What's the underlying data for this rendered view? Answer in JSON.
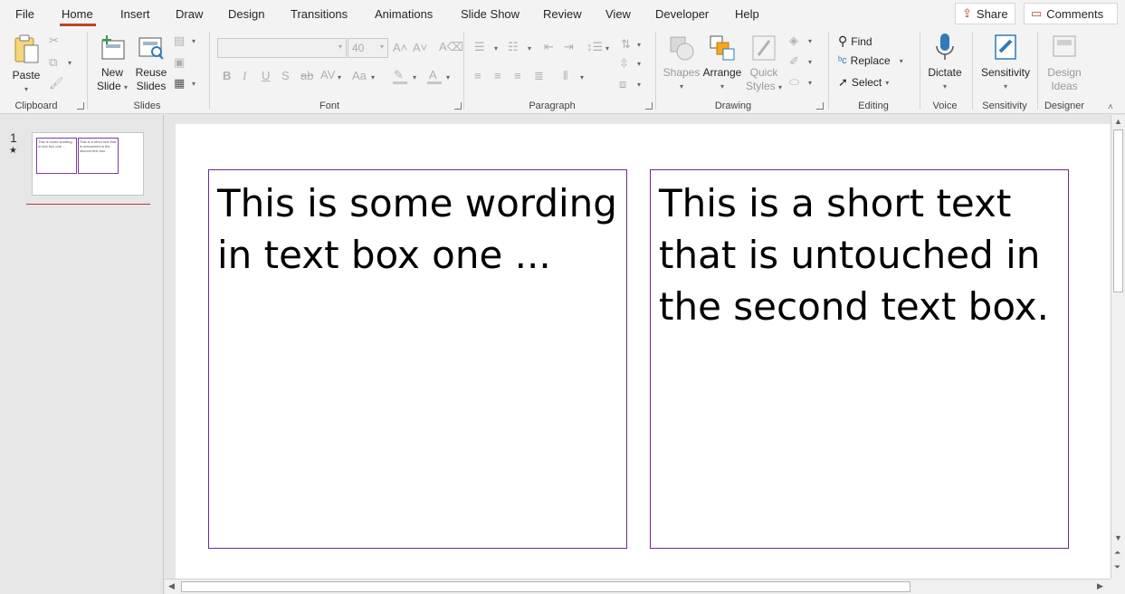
{
  "tabs": [
    "File",
    "Home",
    "Insert",
    "Draw",
    "Design",
    "Transitions",
    "Animations",
    "Slide Show",
    "Review",
    "View",
    "Developer",
    "Help"
  ],
  "active_tab": "Home",
  "header_buttons": {
    "share": "Share",
    "comments": "Comments"
  },
  "ribbon": {
    "clipboard": {
      "label": "Clipboard",
      "paste": "Paste"
    },
    "slides": {
      "label": "Slides",
      "new_slide_1": "New",
      "new_slide_2": "Slide",
      "reuse_1": "Reuse",
      "reuse_2": "Slides"
    },
    "font": {
      "label": "Font",
      "font_name": "",
      "font_size": "40"
    },
    "paragraph": {
      "label": "Paragraph"
    },
    "drawing": {
      "label": "Drawing",
      "shapes": "Shapes",
      "arrange": "Arrange",
      "quick_styles_1": "Quick",
      "quick_styles_2": "Styles"
    },
    "editing": {
      "label": "Editing",
      "find": "Find",
      "replace": "Replace",
      "select": "Select"
    },
    "voice": {
      "label": "Voice",
      "dictate": "Dictate"
    },
    "sensitivity": {
      "label": "Sensitivity",
      "button": "Sensitivity"
    },
    "designer": {
      "label": "Designer",
      "ideas_1": "Design",
      "ideas_2": "Ideas"
    }
  },
  "slide_pane": {
    "number": "1",
    "thumb_text_1": "This is some wording in text box one ...",
    "thumb_text_2": "This is a short text that is untouched in the second text box."
  },
  "slide": {
    "textbox_1": "This is some wording in text box one ...",
    "textbox_2": "This is a short text that is untouched in the second text box."
  },
  "colors": {
    "accent": "#b7472a",
    "textbox_border": "#6b2b8a"
  }
}
